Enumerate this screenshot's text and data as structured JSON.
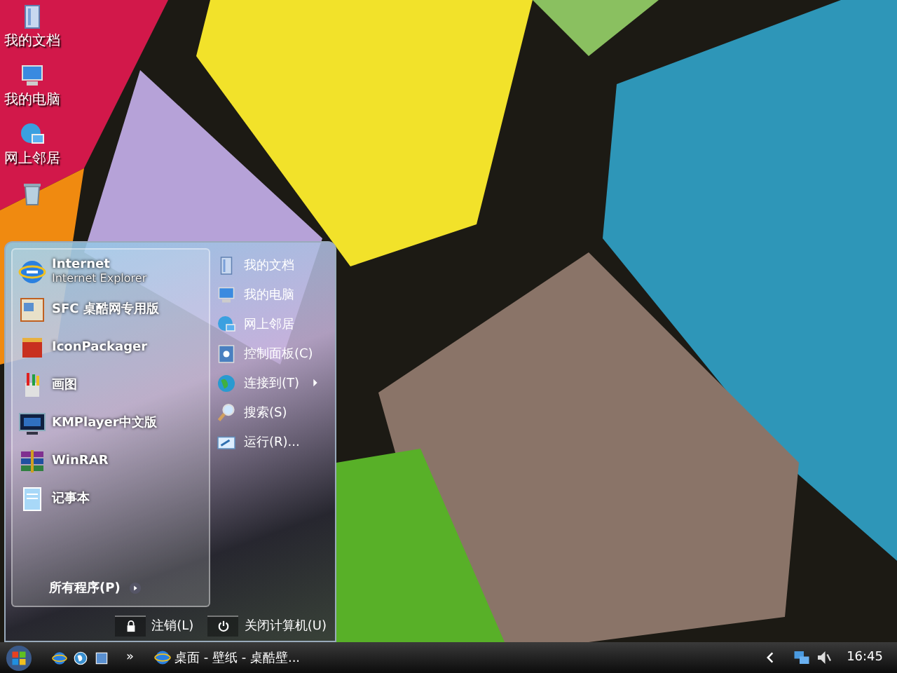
{
  "desktop_icons": [
    {
      "label": "我的文档",
      "kind": "documents"
    },
    {
      "label": "我的电脑",
      "kind": "computer"
    },
    {
      "label": "网上邻居",
      "kind": "network"
    },
    {
      "kind": "recycle"
    }
  ],
  "start_menu": {
    "pinned": [
      {
        "title": "Internet",
        "subtitle": "Internet Explorer",
        "kind": "ie"
      },
      {
        "title": "SFC 桌酷网专用版",
        "kind": "sfc"
      },
      {
        "title": "IconPackager",
        "kind": "iconpackager"
      },
      {
        "title": "画图",
        "kind": "paint"
      },
      {
        "title": "KMPlayer中文版",
        "kind": "kmplayer"
      },
      {
        "title": "WinRAR",
        "kind": "winrar"
      },
      {
        "title": "记事本",
        "kind": "notepad"
      }
    ],
    "all_programs": "所有程序(P)",
    "places": [
      {
        "label": "我的文档",
        "kind": "documents",
        "submenu": false
      },
      {
        "label": "我的电脑",
        "kind": "computer",
        "submenu": false
      },
      {
        "label": "网上邻居",
        "kind": "network",
        "submenu": false
      },
      {
        "label": "控制面板(C)",
        "kind": "control",
        "submenu": false
      },
      {
        "label": "连接到(T)",
        "kind": "connect",
        "submenu": true
      },
      {
        "label": "搜索(S)",
        "kind": "search",
        "submenu": false
      },
      {
        "label": "运行(R)...",
        "kind": "run",
        "submenu": false
      }
    ],
    "logoff": "注销(L)",
    "shutdown": "关闭计算机(U)"
  },
  "taskbar": {
    "quick_launch": [
      {
        "kind": "ie"
      },
      {
        "kind": "globe"
      },
      {
        "kind": "desktop"
      }
    ],
    "overflow": "»",
    "tasks": [
      {
        "label": "桌面 - 壁纸 - 桌酷壁...",
        "kind": "ie"
      }
    ],
    "tray": [
      {
        "kind": "network"
      },
      {
        "kind": "volume"
      }
    ],
    "clock": "16:45"
  }
}
